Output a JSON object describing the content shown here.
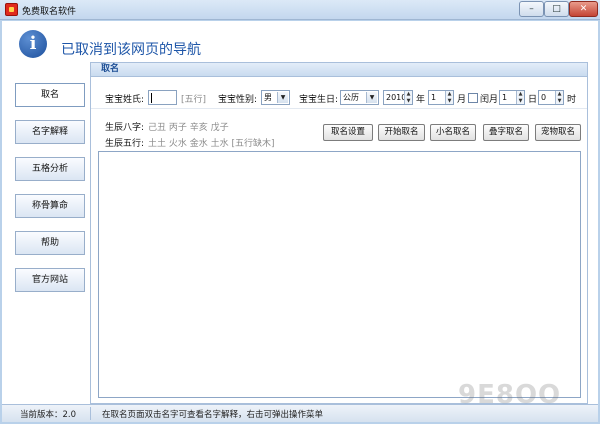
{
  "window": {
    "title": "免费取名软件",
    "minimize_glyph": "–",
    "maximize_glyph": "□",
    "close_glyph": "✕"
  },
  "banner": {
    "icon": "info-icon",
    "icon_glyph": "i",
    "text": "已取消到该网页的导航"
  },
  "sidebar": {
    "items": [
      {
        "label": "取名",
        "active": true
      },
      {
        "label": "名字解释"
      },
      {
        "label": "五格分析"
      },
      {
        "label": "称骨算命"
      },
      {
        "label": "帮助"
      },
      {
        "label": "官方网站"
      }
    ]
  },
  "panel": {
    "title": "取名",
    "surname_label": "宝宝姓氏:",
    "surname_value": "",
    "surname_hint": "[五行]",
    "gender_label": "宝宝性别:",
    "gender_value": "男",
    "birth_label": "宝宝生日:",
    "calendar_value": "公历",
    "year_value": "2010",
    "year_unit": "年",
    "month_value": "1",
    "month_unit": "月",
    "leap_label": "闰月",
    "day_value": "1",
    "day_unit": "日",
    "hour_value": "0",
    "hour_unit": "时",
    "bazi_label": "生辰八字:",
    "bazi_value": "己丑 丙子 辛亥 戊子",
    "wuxing_label": "生辰五行:",
    "wuxing_value": "土土 火水 金水 土水 [五行缺木]",
    "buttons": {
      "settings": "取名设置",
      "start": "开始取名",
      "nickname": "小名取名",
      "double": "叠字取名",
      "pet": "宠物取名"
    }
  },
  "status": {
    "version": "当前版本：2.0",
    "hint": "在取名页面双击名字可查看名字解释，右击可弹出操作菜单"
  },
  "watermark": "9E8OO"
}
